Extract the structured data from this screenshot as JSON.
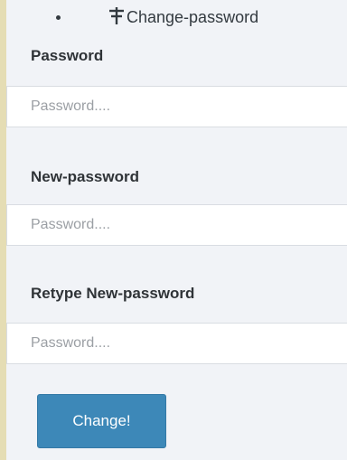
{
  "breadcrumb": {
    "icon": "sliders-icon",
    "label": "Change-password"
  },
  "form": {
    "password_label": "Password",
    "password_placeholder": "Password....",
    "new_password_label": "New-password",
    "new_password_placeholder": "Password....",
    "retype_label": "Retype New-password",
    "retype_placeholder": "Password....",
    "submit_label": "Change!"
  },
  "colors": {
    "outer_background": "#e5ddb4",
    "panel_background": "#f1f3f7",
    "button": "#3d88b8"
  }
}
